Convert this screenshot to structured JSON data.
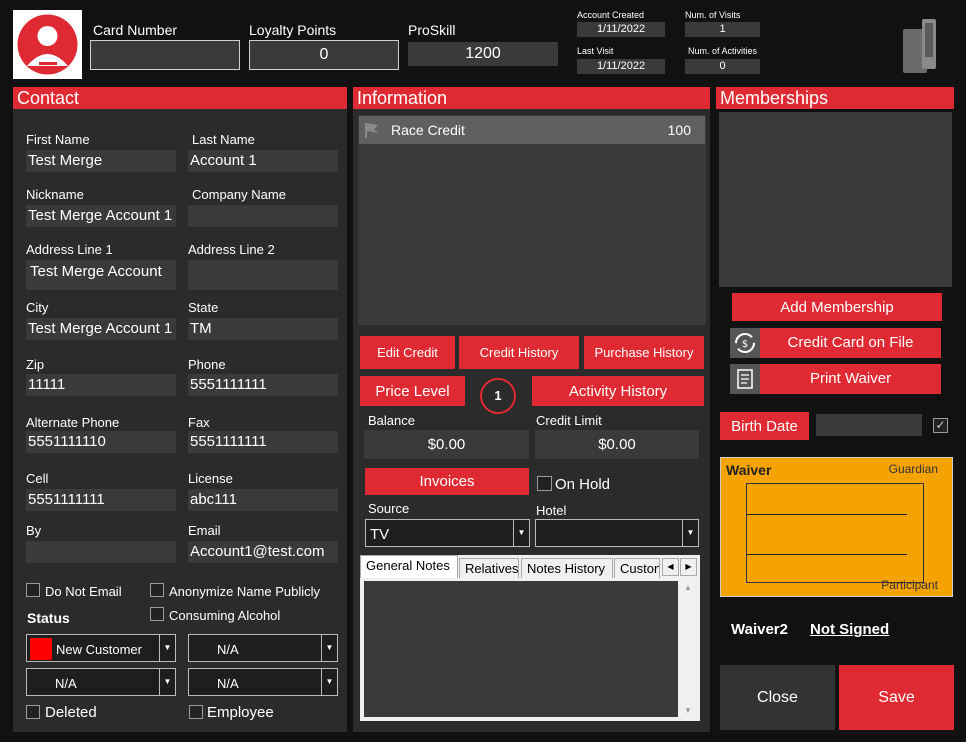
{
  "top": {
    "card_number_label": "Card Number",
    "card_number_value": "",
    "loyalty_label": "Loyalty Points",
    "loyalty_value": "0",
    "proskill_label": "ProSkill",
    "proskill_value": "1200",
    "account_created_label": "Account Created",
    "account_created_value": "1/11/2022",
    "last_visit_label": "Last Visit",
    "last_visit_value": "1/11/2022",
    "num_visits_label": "Num. of Visits",
    "num_visits_value": "1",
    "num_activities_label": "Num. of Activities",
    "num_activities_value": "0"
  },
  "contact": {
    "header": "Contact",
    "first_name_label": "First Name",
    "first_name": "Test Merge",
    "last_name_label": "Last Name",
    "last_name": "Account 1",
    "nickname_label": "Nickname",
    "nickname": "Test Merge Account 1",
    "company_label": "Company Name",
    "company": "",
    "address1_label": "Address Line 1",
    "address1": "Test Merge Account",
    "address2_label": "Address Line 2",
    "address2": "",
    "city_label": "City",
    "city": "Test Merge Account 1",
    "state_label": "State",
    "state": "TM",
    "zip_label": "Zip",
    "zip": "11111",
    "phone_label": "Phone",
    "phone": "5551111111",
    "alt_phone_label": "Alternate Phone",
    "alt_phone": "5551111110",
    "fax_label": "Fax",
    "fax": "5551111111",
    "cell_label": "Cell",
    "cell": "5551111111",
    "license_label": "License",
    "license": "abc111",
    "by_label": "By",
    "by": "",
    "email_label": "Email",
    "email": "Account1@test.com",
    "do_not_email": "Do Not Email",
    "anonymize": "Anonymize Name Publicly",
    "consuming_alcohol": "Consuming Alcohol",
    "status_label": "Status",
    "status_value": "New Customer",
    "combo_na_1": "N/A",
    "combo_na_2": "N/A",
    "combo_na_3": "N/A",
    "deleted": "Deleted",
    "employee": "Employee",
    "status_color": "#ff0000"
  },
  "info": {
    "header": "Information",
    "credit_name": "Race Credit",
    "credit_value": "100",
    "edit_credit": "Edit Credit",
    "credit_history": "Credit History",
    "purchase_history": "Purchase History",
    "price_level": "Price Level",
    "price_level_num": "1",
    "activity_history": "Activity History",
    "balance_label": "Balance",
    "balance_value": "$0.00",
    "credit_limit_label": "Credit Limit",
    "credit_limit_value": "$0.00",
    "invoices": "Invoices",
    "on_hold": "On Hold",
    "source_label": "Source",
    "source_value": "TV",
    "hotel_label": "Hotel",
    "hotel_value": "",
    "tabs": [
      "General Notes",
      "Relatives",
      "Notes History",
      "Custon"
    ]
  },
  "memberships": {
    "header": "Memberships",
    "add_membership": "Add Membership",
    "credit_card_on_file": "Credit Card on File",
    "print_waiver": "Print Waiver",
    "birth_date": "Birth Date",
    "birth_date_value": "",
    "waiver_title": "Waiver",
    "guardian": "Guardian",
    "participant": "Participant",
    "waiver2_label": "Waiver2",
    "waiver2_status": "Not Signed",
    "close": "Close",
    "save": "Save"
  },
  "colors": {
    "accent": "#e02a33",
    "panel": "#2b2b2b",
    "waiver_bg": "#f5a300"
  },
  "icons": [
    "avatar-icon",
    "card-reader-icon",
    "flag-icon",
    "refresh-card-icon",
    "document-icon",
    "check-icon",
    "chevron-down-icon"
  ]
}
